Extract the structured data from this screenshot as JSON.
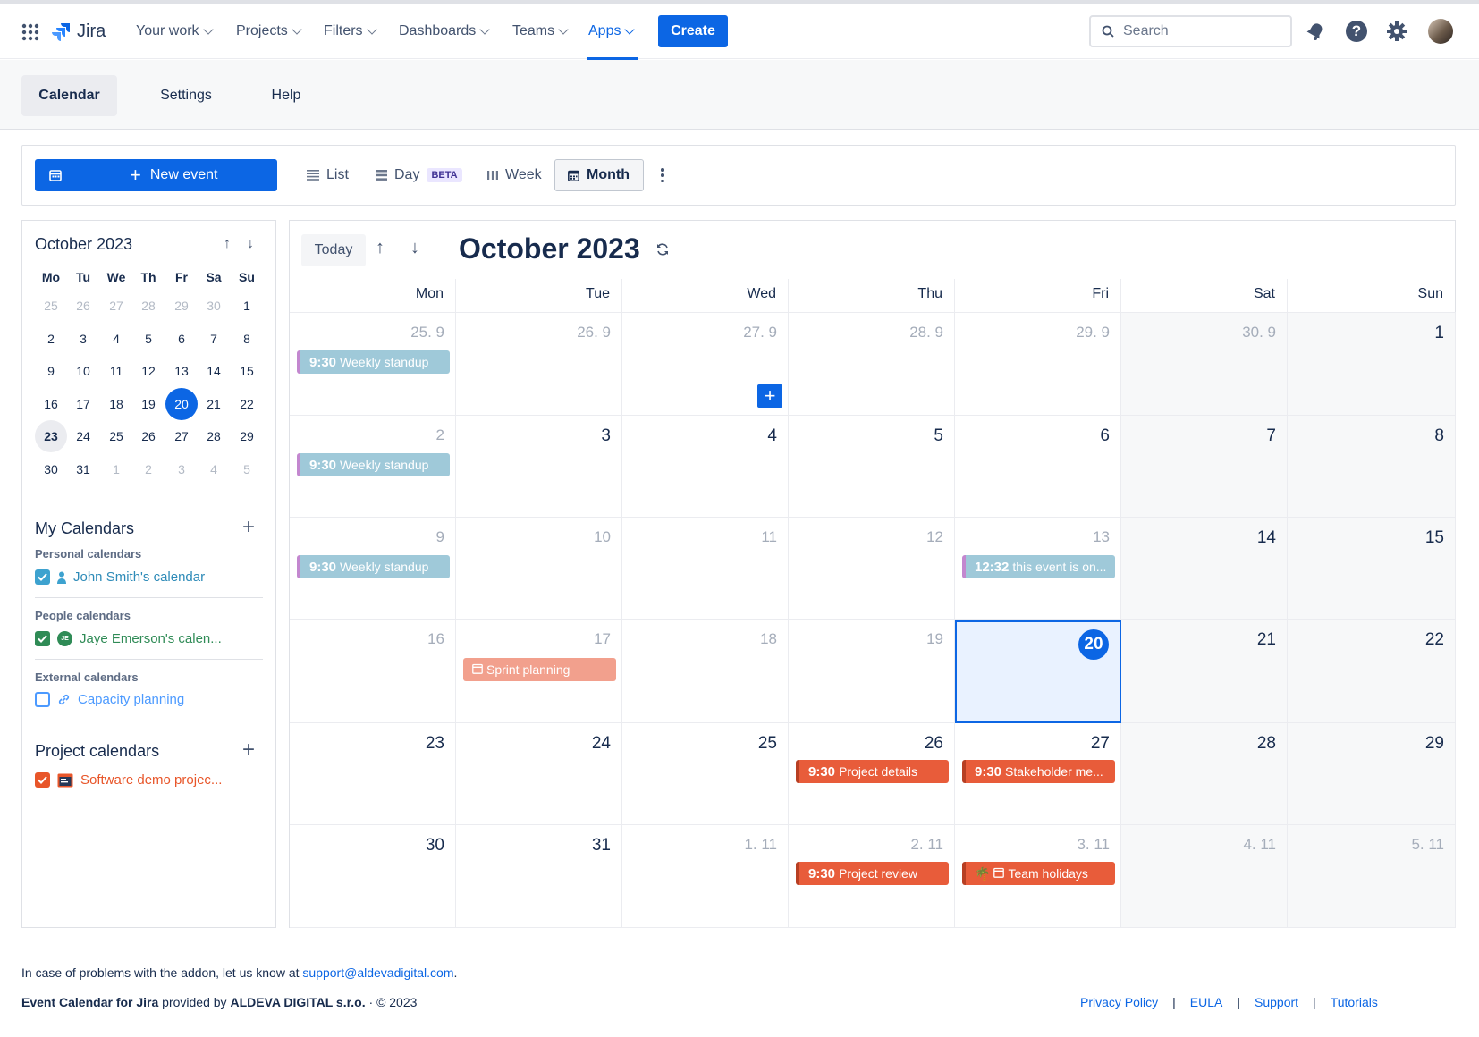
{
  "topnav": {
    "logo": "Jira",
    "items": [
      "Your work",
      "Projects",
      "Filters",
      "Dashboards",
      "Teams",
      "Apps"
    ],
    "create": "Create",
    "search_placeholder": "Search"
  },
  "subnav": {
    "tabs": [
      "Calendar",
      "Settings",
      "Help"
    ]
  },
  "toolbar": {
    "new_event": "New event",
    "views": [
      "List",
      "Day",
      "Week",
      "Month"
    ],
    "beta": "BETA"
  },
  "mini": {
    "title": "October 2023",
    "weekdays": [
      "Mo",
      "Tu",
      "We",
      "Th",
      "Fr",
      "Sa",
      "Su"
    ],
    "weeks": [
      [
        "25",
        "26",
        "27",
        "28",
        "29",
        "30",
        "1"
      ],
      [
        "2",
        "3",
        "4",
        "5",
        "6",
        "7",
        "8"
      ],
      [
        "9",
        "10",
        "11",
        "12",
        "13",
        "14",
        "15"
      ],
      [
        "16",
        "17",
        "18",
        "19",
        "20",
        "21",
        "22"
      ],
      [
        "23",
        "24",
        "25",
        "26",
        "27",
        "28",
        "29"
      ],
      [
        "30",
        "31",
        "1",
        "2",
        "3",
        "4",
        "5"
      ]
    ]
  },
  "my_calendars": {
    "title": "My Calendars",
    "personal_label": "Personal calendars",
    "personal": "John Smith's calendar",
    "people_label": "People calendars",
    "people": "Jaye Emerson's calen...",
    "people_initial": "JE",
    "external_label": "External calendars",
    "external": "Capacity planning"
  },
  "project_calendars": {
    "title": "Project calendars",
    "item": "Software demo projec..."
  },
  "month": {
    "today_btn": "Today",
    "title": "October 2023",
    "weekdays": [
      "Mon",
      "Tue",
      "Wed",
      "Thu",
      "Fri",
      "Sat",
      "Sun"
    ],
    "weeks": [
      [
        "25. 9",
        "26. 9",
        "27. 9",
        "28. 9",
        "29. 9",
        "30. 9",
        "1"
      ],
      [
        "2",
        "3",
        "4",
        "5",
        "6",
        "7",
        "8"
      ],
      [
        "9",
        "10",
        "11",
        "12",
        "13",
        "14",
        "15"
      ],
      [
        "16",
        "17",
        "18",
        "19",
        "20",
        "21",
        "22"
      ],
      [
        "23",
        "24",
        "25",
        "26",
        "27",
        "28",
        "29"
      ],
      [
        "30",
        "31",
        "1. 11",
        "2. 11",
        "3. 11",
        "4. 11",
        "5. 11"
      ]
    ]
  },
  "events": [
    {
      "week": 0,
      "day": 0,
      "time": "9:30",
      "title": "Weekly standup",
      "style": "blue"
    },
    {
      "week": 1,
      "day": 0,
      "time": "9:30",
      "title": "Weekly standup",
      "style": "blue"
    },
    {
      "week": 2,
      "day": 0,
      "time": "9:30",
      "title": "Weekly standup",
      "style": "blue"
    },
    {
      "week": 2,
      "day": 4,
      "time": "12:32",
      "title": "this event is on...",
      "style": "blue"
    },
    {
      "week": 3,
      "day": 1,
      "time": "",
      "title": "Sprint planning",
      "style": "salmon"
    },
    {
      "week": 4,
      "day": 3,
      "time": "9:30",
      "title": "Project details",
      "style": "orange"
    },
    {
      "week": 4,
      "day": 4,
      "time": "9:30",
      "title": "Stakeholder me...",
      "style": "orange"
    },
    {
      "week": 5,
      "day": 3,
      "time": "9:30",
      "title": "Project review",
      "style": "orange"
    },
    {
      "week": 5,
      "day": 4,
      "time": "",
      "title": "Team holidays",
      "style": "orange"
    }
  ],
  "footer": {
    "problem_prefix": "In case of problems with the addon, let us know at",
    "email": "support@aldevadigital.com",
    "period": ".",
    "product": "Event Calendar for Jira",
    "provided_by": "provided by",
    "company": "ALDEVA DIGITAL s.r.o.",
    "copyright": "· © 2023",
    "links": [
      "Privacy Policy",
      "EULA",
      "Support",
      "Tutorials"
    ]
  },
  "colors": {
    "accent": "#0c66e4",
    "event_blue": "#9fc9d9",
    "event_orange": "#e85c3a",
    "event_salmon": "#f2a08d"
  }
}
